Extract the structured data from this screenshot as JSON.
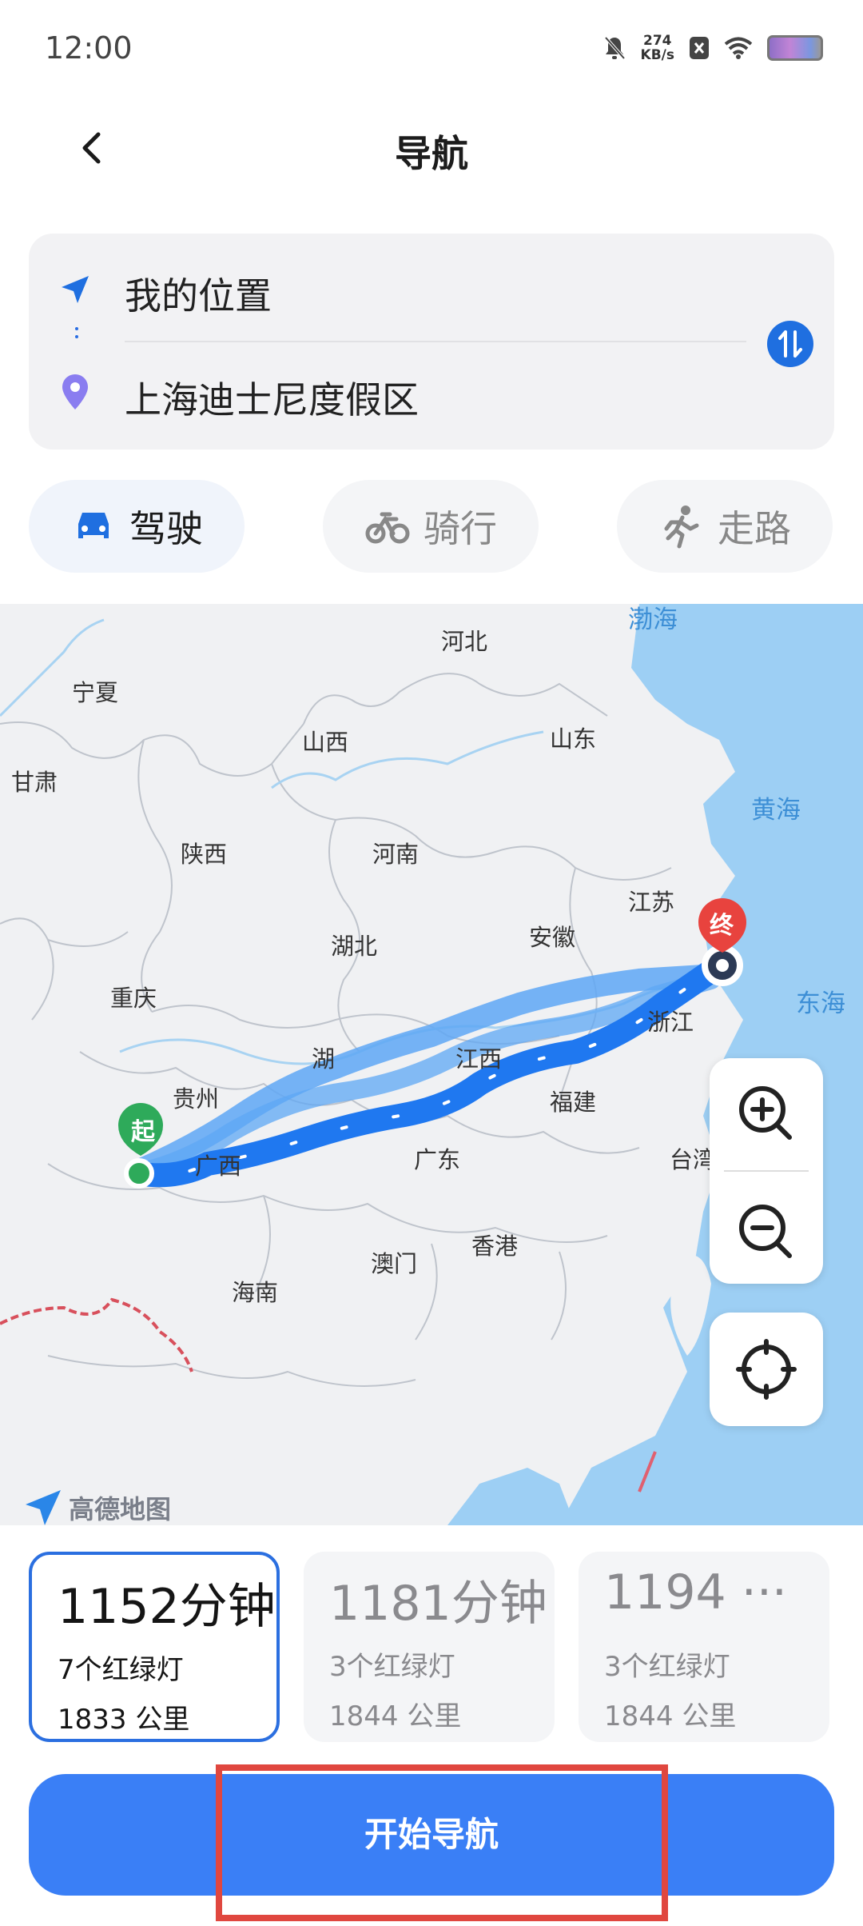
{
  "status": {
    "time": "12:00",
    "speed_value": "274",
    "speed_unit": "KB/s"
  },
  "header": {
    "title": "导航",
    "back_icon": "chevron-left-icon"
  },
  "route": {
    "from": "我的位置",
    "to": "上海迪士尼度假区",
    "swap_icon": "swap-icon"
  },
  "modes": [
    {
      "label": "驾驶",
      "icon": "car-icon",
      "active": true
    },
    {
      "label": "骑行",
      "icon": "bike-icon",
      "active": false
    },
    {
      "label": "走路",
      "icon": "walk-icon",
      "active": false
    }
  ],
  "map": {
    "labels": {
      "hebei": "河北",
      "ningxia": "宁夏",
      "shanxi1": "山西",
      "shandong": "山东",
      "gansu": "甘肃",
      "shaanxi": "陕西",
      "henan": "河南",
      "huanghai": "黄海",
      "jiangsu": "江苏",
      "anhui": "安徽",
      "hubei": "湖北",
      "chongqing": "重庆",
      "donghai": "东海",
      "zhejiang": "浙江",
      "hunan": "湖",
      "jiangxi": "江西",
      "guizhou": "贵州",
      "fujian": "福建",
      "guangxi": "广西",
      "guangdong": "广东",
      "taiwan": "台湾",
      "aomen": "澳门",
      "xianggang": "香港",
      "hainan": "海南",
      "bohai": "渤海"
    },
    "start_marker": "起",
    "end_marker": "终",
    "logo": "高德地图",
    "zoom_in_icon": "zoom-in-icon",
    "zoom_out_icon": "zoom-out-icon",
    "locate_icon": "crosshair-icon"
  },
  "route_options": [
    {
      "time": "1152分钟",
      "lights": "7个红绿灯",
      "distance": "1833 公里",
      "selected": true
    },
    {
      "time": "1181分钟",
      "lights": "3个红绿灯",
      "distance": "1844 公里",
      "selected": false
    },
    {
      "time": "1194 ···",
      "lights": "3个红绿灯",
      "distance": "1844 公里",
      "selected": false
    }
  ],
  "action": {
    "start_label": "开始导航"
  },
  "colors": {
    "accent": "#3a7ff6",
    "route": "#1f78f0",
    "highlight": "#e0473f",
    "start_marker": "#2eaa5a",
    "end_marker": "#e8433e",
    "sea": "#9dcff4"
  }
}
